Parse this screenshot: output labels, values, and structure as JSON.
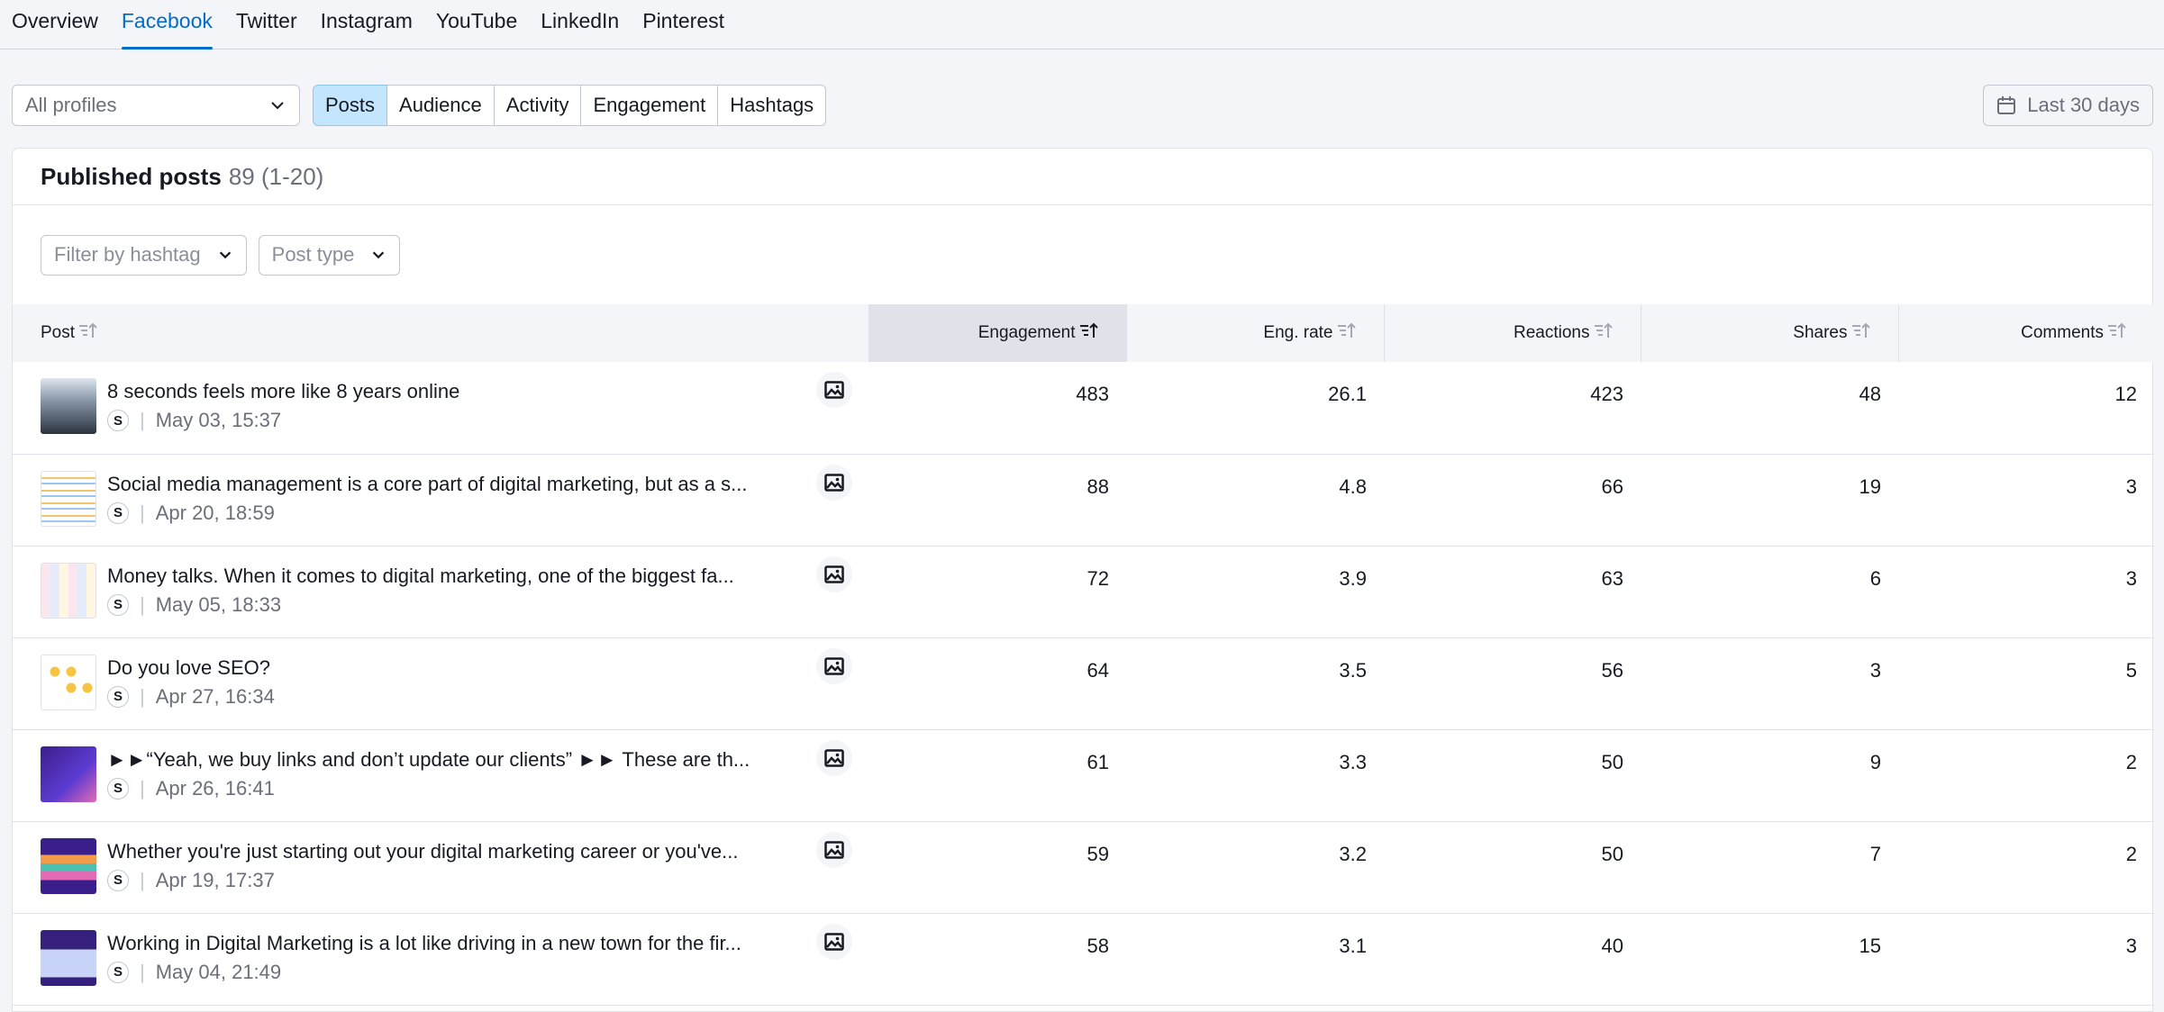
{
  "tabs": [
    "Overview",
    "Facebook",
    "Twitter",
    "Instagram",
    "YouTube",
    "LinkedIn",
    "Pinterest"
  ],
  "active_tab": "Facebook",
  "profile_select": "All profiles",
  "segments": [
    "Posts",
    "Audience",
    "Activity",
    "Engagement",
    "Hashtags"
  ],
  "active_segment": "Posts",
  "date_range": "Last 30 days",
  "card": {
    "title": "Published posts",
    "count": "89 (1-20)",
    "filter_hashtag": "Filter by hashtag",
    "filter_type": "Post type"
  },
  "columns": [
    "Post",
    "Engagement",
    "Eng. rate",
    "Reactions",
    "Shares",
    "Comments"
  ],
  "sorted_column": "Engagement",
  "profile_badge": "S",
  "rows": [
    {
      "title": "8 seconds feels more like 8 years online",
      "date": "May 03, 15:37",
      "engagement": "483",
      "eng_rate": "26.1",
      "reactions": "423",
      "shares": "48",
      "comments": "12",
      "thumb": "photo"
    },
    {
      "title": "Social media management is a core part of digital marketing, but as a s...",
      "date": "Apr 20, 18:59",
      "engagement": "88",
      "eng_rate": "4.8",
      "reactions": "66",
      "shares": "19",
      "comments": "3",
      "thumb": "list"
    },
    {
      "title": "Money talks. When it comes to digital marketing, one of the biggest fa...",
      "date": "May 05, 18:33",
      "engagement": "72",
      "eng_rate": "3.9",
      "reactions": "63",
      "shares": "6",
      "comments": "3",
      "thumb": "grid"
    },
    {
      "title": "Do you love SEO?",
      "date": "Apr 27, 16:34",
      "engagement": "64",
      "eng_rate": "3.5",
      "reactions": "56",
      "shares": "3",
      "comments": "5",
      "thumb": "emoji"
    },
    {
      "title": "►►“Yeah, we buy links and don’t update our clients” ►► These are th...",
      "date": "Apr 26, 16:41",
      "engagement": "61",
      "eng_rate": "3.3",
      "reactions": "50",
      "shares": "9",
      "comments": "2",
      "thumb": "purple"
    },
    {
      "title": "Whether you're just starting out your digital marketing career or you've...",
      "date": "Apr 19, 17:37",
      "engagement": "59",
      "eng_rate": "3.2",
      "reactions": "50",
      "shares": "7",
      "comments": "2",
      "thumb": "purple2"
    },
    {
      "title": "Working in Digital Marketing is a lot like driving in a new town for the fir...",
      "date": "May 04, 21:49",
      "engagement": "58",
      "eng_rate": "3.1",
      "reactions": "40",
      "shares": "15",
      "comments": "3",
      "thumb": "purple3"
    }
  ]
}
